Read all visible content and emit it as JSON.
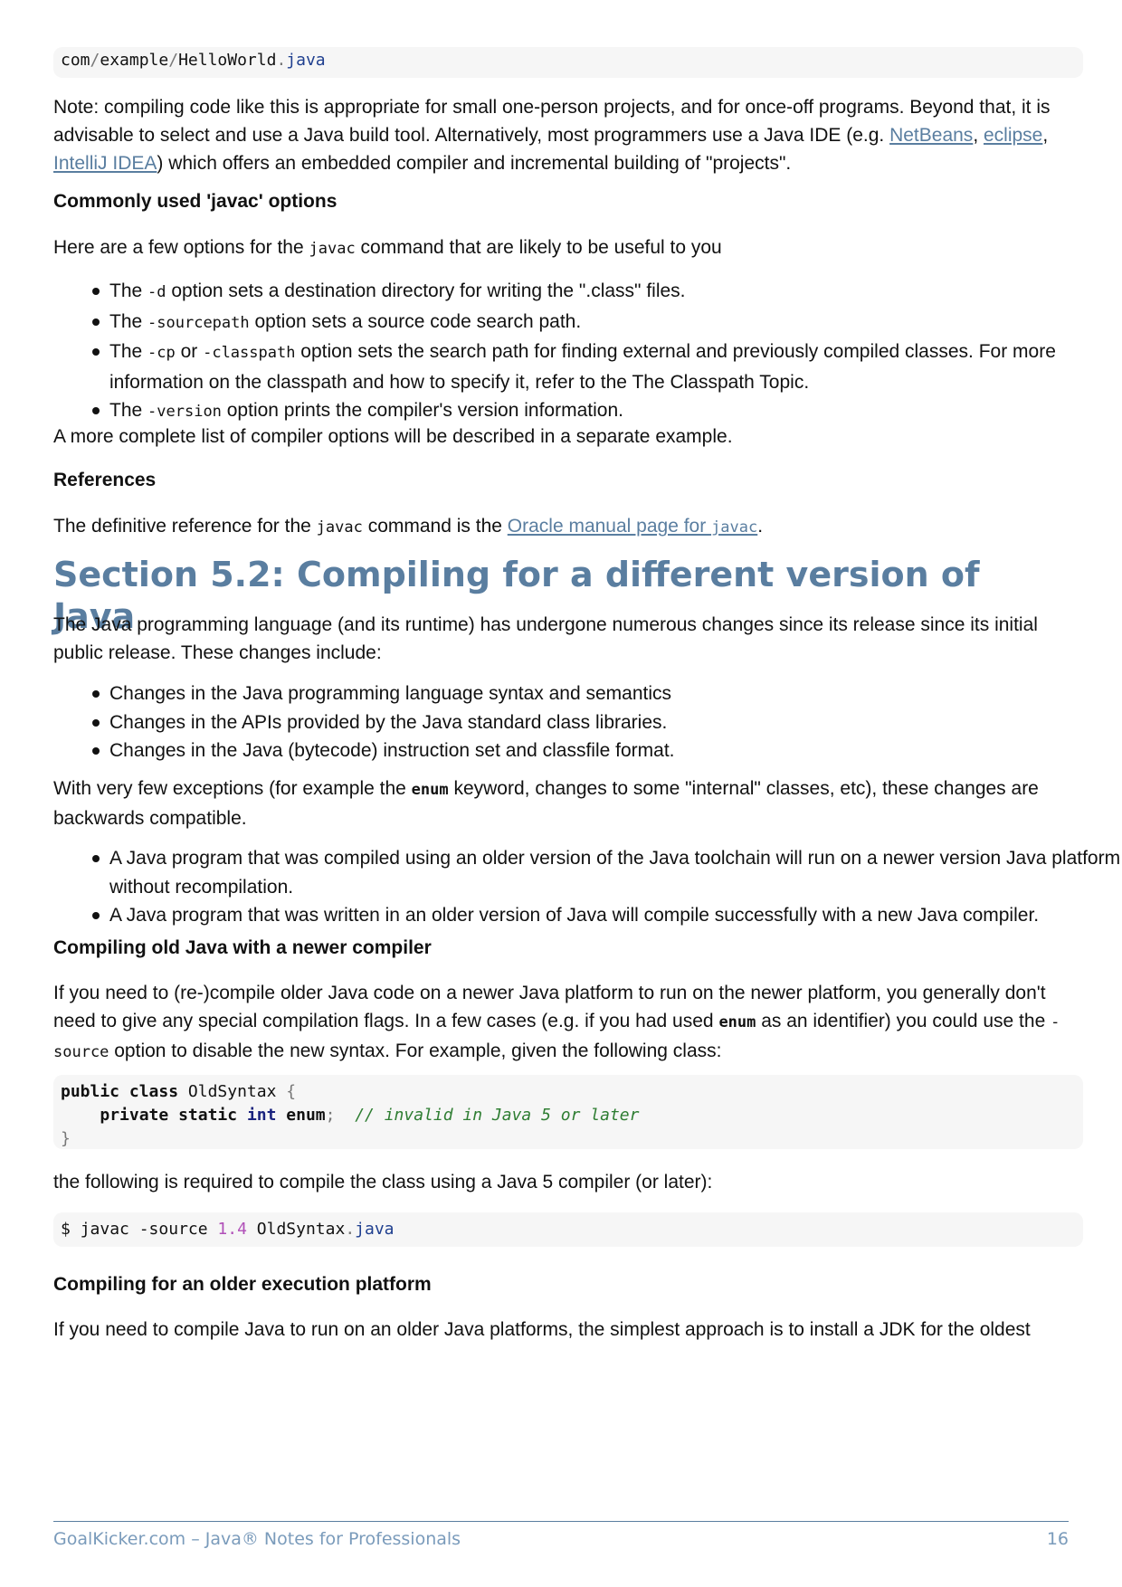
{
  "top_code": {
    "path_a": "com",
    "sep": "/",
    "path_b": "example",
    "path_c": "HelloWorld",
    "dot": ".",
    "ext": "java"
  },
  "note": {
    "text_a": "Note: compiling code like this is appropriate for small one-person projects, and for once-off programs. Beyond that, it is advisable to select and use a Java build tool. Alternatively, most programmers use a Java IDE (e.g. ",
    "link_netbeans": "NetBeans",
    "comma1": ", ",
    "link_eclipse": "eclipse",
    "comma2": ", ",
    "link_intellij": "IntelliJ IDEA",
    "text_b": ") which offers an embedded compiler and incremental building of \"projects\"."
  },
  "options_heading": "Commonly used 'javac' options",
  "options_intro": {
    "before": "Here are a few options for the ",
    "code": "javac",
    "after": " command that are likely to be useful to you"
  },
  "options": [
    {
      "the": "The ",
      "code": "-d",
      "rest": " option sets a destination directory for writing the \".class\" files."
    },
    {
      "the": "The ",
      "code": "-sourcepath",
      "rest": " option sets a source code search path."
    },
    {
      "the": "The ",
      "code": "-cp",
      "or": " or ",
      "code2": "-classpath",
      "rest": " option sets the search path for finding external and previously compiled classes. For more information on the classpath and how to specify it, refer to the The Classpath Topic."
    },
    {
      "the": "The ",
      "code": "-version",
      "rest": " option prints the compiler's version information."
    }
  ],
  "options_more": "A more complete list of compiler options will be described in a separate example.",
  "references_heading": "References",
  "references": {
    "before": "The definitive reference for the ",
    "code": "javac",
    "middle": " command is the ",
    "link_text": "Oracle manual page for ",
    "link_code": "javac",
    "after": "."
  },
  "section_title": "Section 5.2: Compiling for a different version of Java",
  "section_intro": "The Java programming language (and its runtime) has undergone numerous changes since its release since its initial public release. These changes include:",
  "changes": [
    "Changes in the Java programming language syntax and semantics",
    "Changes in the APIs provided by the Java standard class libraries.",
    "Changes in the Java (bytecode) instruction set and classfile format."
  ],
  "compat": {
    "before": "With very few exceptions (for example the ",
    "code": "enum",
    "after": " keyword, changes to some \"internal\" classes, etc), these changes are backwards compatible."
  },
  "compat_points": [
    "A Java program that was compiled using an older version of the Java toolchain will run on a newer version Java platform without recompilation.",
    "A Java program that was written in an older version of Java will compile successfully with a new Java compiler."
  ],
  "old_heading": "Compiling old Java with a newer compiler",
  "old_para": {
    "a": "If you need to (re-)compile older Java code on a newer Java platform to run on the newer platform, you generally don't need to give any special compilation flags. In a few cases (e.g. if you had used ",
    "code": "enum",
    "b": " as an identifier) you could use the ",
    "code2": "-source",
    "c": " option to disable the new syntax. For example, given the following class:"
  },
  "class_code": {
    "public": "public",
    "class": "class",
    "name": "OldSyntax",
    "lbrace": "{",
    "private": "private",
    "static": "static",
    "int": "int",
    "enum": "enum",
    "semi": ";",
    "comment": "// invalid in Java 5 or later",
    "rbrace": "}"
  },
  "required_para": "the following is required to compile the class using a Java 5 compiler (or later):",
  "cmd_code": {
    "prompt": "$",
    "cmd": "javac",
    "flag": "-source",
    "version": "1.4",
    "file": "OldSyntax",
    "dot": ".",
    "ext": "java"
  },
  "older_heading": "Compiling for an older execution platform",
  "older_para": "If you need to compile Java to run on an older Java platforms, the simplest approach is to install a JDK for the oldest",
  "footer": {
    "left": "GoalKicker.com – Java® Notes for Professionals",
    "page": "16"
  }
}
